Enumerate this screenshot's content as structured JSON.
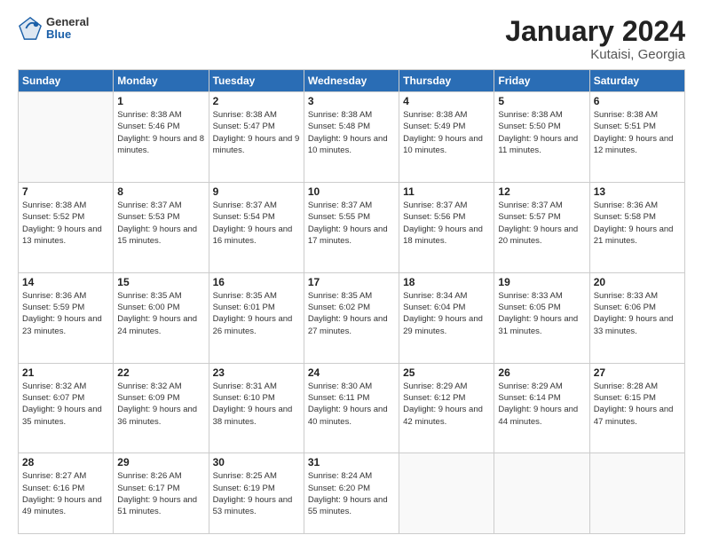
{
  "header": {
    "logo": {
      "general": "General",
      "blue": "Blue"
    },
    "title": "January 2024",
    "location": "Kutaisi, Georgia"
  },
  "weekdays": [
    "Sunday",
    "Monday",
    "Tuesday",
    "Wednesday",
    "Thursday",
    "Friday",
    "Saturday"
  ],
  "weeks": [
    [
      {
        "day": "",
        "empty": true
      },
      {
        "day": "1",
        "sunrise": "Sunrise: 8:38 AM",
        "sunset": "Sunset: 5:46 PM",
        "daylight": "Daylight: 9 hours and 8 minutes."
      },
      {
        "day": "2",
        "sunrise": "Sunrise: 8:38 AM",
        "sunset": "Sunset: 5:47 PM",
        "daylight": "Daylight: 9 hours and 9 minutes."
      },
      {
        "day": "3",
        "sunrise": "Sunrise: 8:38 AM",
        "sunset": "Sunset: 5:48 PM",
        "daylight": "Daylight: 9 hours and 10 minutes."
      },
      {
        "day": "4",
        "sunrise": "Sunrise: 8:38 AM",
        "sunset": "Sunset: 5:49 PM",
        "daylight": "Daylight: 9 hours and 10 minutes."
      },
      {
        "day": "5",
        "sunrise": "Sunrise: 8:38 AM",
        "sunset": "Sunset: 5:50 PM",
        "daylight": "Daylight: 9 hours and 11 minutes."
      },
      {
        "day": "6",
        "sunrise": "Sunrise: 8:38 AM",
        "sunset": "Sunset: 5:51 PM",
        "daylight": "Daylight: 9 hours and 12 minutes."
      }
    ],
    [
      {
        "day": "7",
        "sunrise": "Sunrise: 8:38 AM",
        "sunset": "Sunset: 5:52 PM",
        "daylight": "Daylight: 9 hours and 13 minutes."
      },
      {
        "day": "8",
        "sunrise": "Sunrise: 8:37 AM",
        "sunset": "Sunset: 5:53 PM",
        "daylight": "Daylight: 9 hours and 15 minutes."
      },
      {
        "day": "9",
        "sunrise": "Sunrise: 8:37 AM",
        "sunset": "Sunset: 5:54 PM",
        "daylight": "Daylight: 9 hours and 16 minutes."
      },
      {
        "day": "10",
        "sunrise": "Sunrise: 8:37 AM",
        "sunset": "Sunset: 5:55 PM",
        "daylight": "Daylight: 9 hours and 17 minutes."
      },
      {
        "day": "11",
        "sunrise": "Sunrise: 8:37 AM",
        "sunset": "Sunset: 5:56 PM",
        "daylight": "Daylight: 9 hours and 18 minutes."
      },
      {
        "day": "12",
        "sunrise": "Sunrise: 8:37 AM",
        "sunset": "Sunset: 5:57 PM",
        "daylight": "Daylight: 9 hours and 20 minutes."
      },
      {
        "day": "13",
        "sunrise": "Sunrise: 8:36 AM",
        "sunset": "Sunset: 5:58 PM",
        "daylight": "Daylight: 9 hours and 21 minutes."
      }
    ],
    [
      {
        "day": "14",
        "sunrise": "Sunrise: 8:36 AM",
        "sunset": "Sunset: 5:59 PM",
        "daylight": "Daylight: 9 hours and 23 minutes."
      },
      {
        "day": "15",
        "sunrise": "Sunrise: 8:35 AM",
        "sunset": "Sunset: 6:00 PM",
        "daylight": "Daylight: 9 hours and 24 minutes."
      },
      {
        "day": "16",
        "sunrise": "Sunrise: 8:35 AM",
        "sunset": "Sunset: 6:01 PM",
        "daylight": "Daylight: 9 hours and 26 minutes."
      },
      {
        "day": "17",
        "sunrise": "Sunrise: 8:35 AM",
        "sunset": "Sunset: 6:02 PM",
        "daylight": "Daylight: 9 hours and 27 minutes."
      },
      {
        "day": "18",
        "sunrise": "Sunrise: 8:34 AM",
        "sunset": "Sunset: 6:04 PM",
        "daylight": "Daylight: 9 hours and 29 minutes."
      },
      {
        "day": "19",
        "sunrise": "Sunrise: 8:33 AM",
        "sunset": "Sunset: 6:05 PM",
        "daylight": "Daylight: 9 hours and 31 minutes."
      },
      {
        "day": "20",
        "sunrise": "Sunrise: 8:33 AM",
        "sunset": "Sunset: 6:06 PM",
        "daylight": "Daylight: 9 hours and 33 minutes."
      }
    ],
    [
      {
        "day": "21",
        "sunrise": "Sunrise: 8:32 AM",
        "sunset": "Sunset: 6:07 PM",
        "daylight": "Daylight: 9 hours and 35 minutes."
      },
      {
        "day": "22",
        "sunrise": "Sunrise: 8:32 AM",
        "sunset": "Sunset: 6:09 PM",
        "daylight": "Daylight: 9 hours and 36 minutes."
      },
      {
        "day": "23",
        "sunrise": "Sunrise: 8:31 AM",
        "sunset": "Sunset: 6:10 PM",
        "daylight": "Daylight: 9 hours and 38 minutes."
      },
      {
        "day": "24",
        "sunrise": "Sunrise: 8:30 AM",
        "sunset": "Sunset: 6:11 PM",
        "daylight": "Daylight: 9 hours and 40 minutes."
      },
      {
        "day": "25",
        "sunrise": "Sunrise: 8:29 AM",
        "sunset": "Sunset: 6:12 PM",
        "daylight": "Daylight: 9 hours and 42 minutes."
      },
      {
        "day": "26",
        "sunrise": "Sunrise: 8:29 AM",
        "sunset": "Sunset: 6:14 PM",
        "daylight": "Daylight: 9 hours and 44 minutes."
      },
      {
        "day": "27",
        "sunrise": "Sunrise: 8:28 AM",
        "sunset": "Sunset: 6:15 PM",
        "daylight": "Daylight: 9 hours and 47 minutes."
      }
    ],
    [
      {
        "day": "28",
        "sunrise": "Sunrise: 8:27 AM",
        "sunset": "Sunset: 6:16 PM",
        "daylight": "Daylight: 9 hours and 49 minutes."
      },
      {
        "day": "29",
        "sunrise": "Sunrise: 8:26 AM",
        "sunset": "Sunset: 6:17 PM",
        "daylight": "Daylight: 9 hours and 51 minutes."
      },
      {
        "day": "30",
        "sunrise": "Sunrise: 8:25 AM",
        "sunset": "Sunset: 6:19 PM",
        "daylight": "Daylight: 9 hours and 53 minutes."
      },
      {
        "day": "31",
        "sunrise": "Sunrise: 8:24 AM",
        "sunset": "Sunset: 6:20 PM",
        "daylight": "Daylight: 9 hours and 55 minutes."
      },
      {
        "day": "",
        "empty": true
      },
      {
        "day": "",
        "empty": true
      },
      {
        "day": "",
        "empty": true
      }
    ]
  ]
}
